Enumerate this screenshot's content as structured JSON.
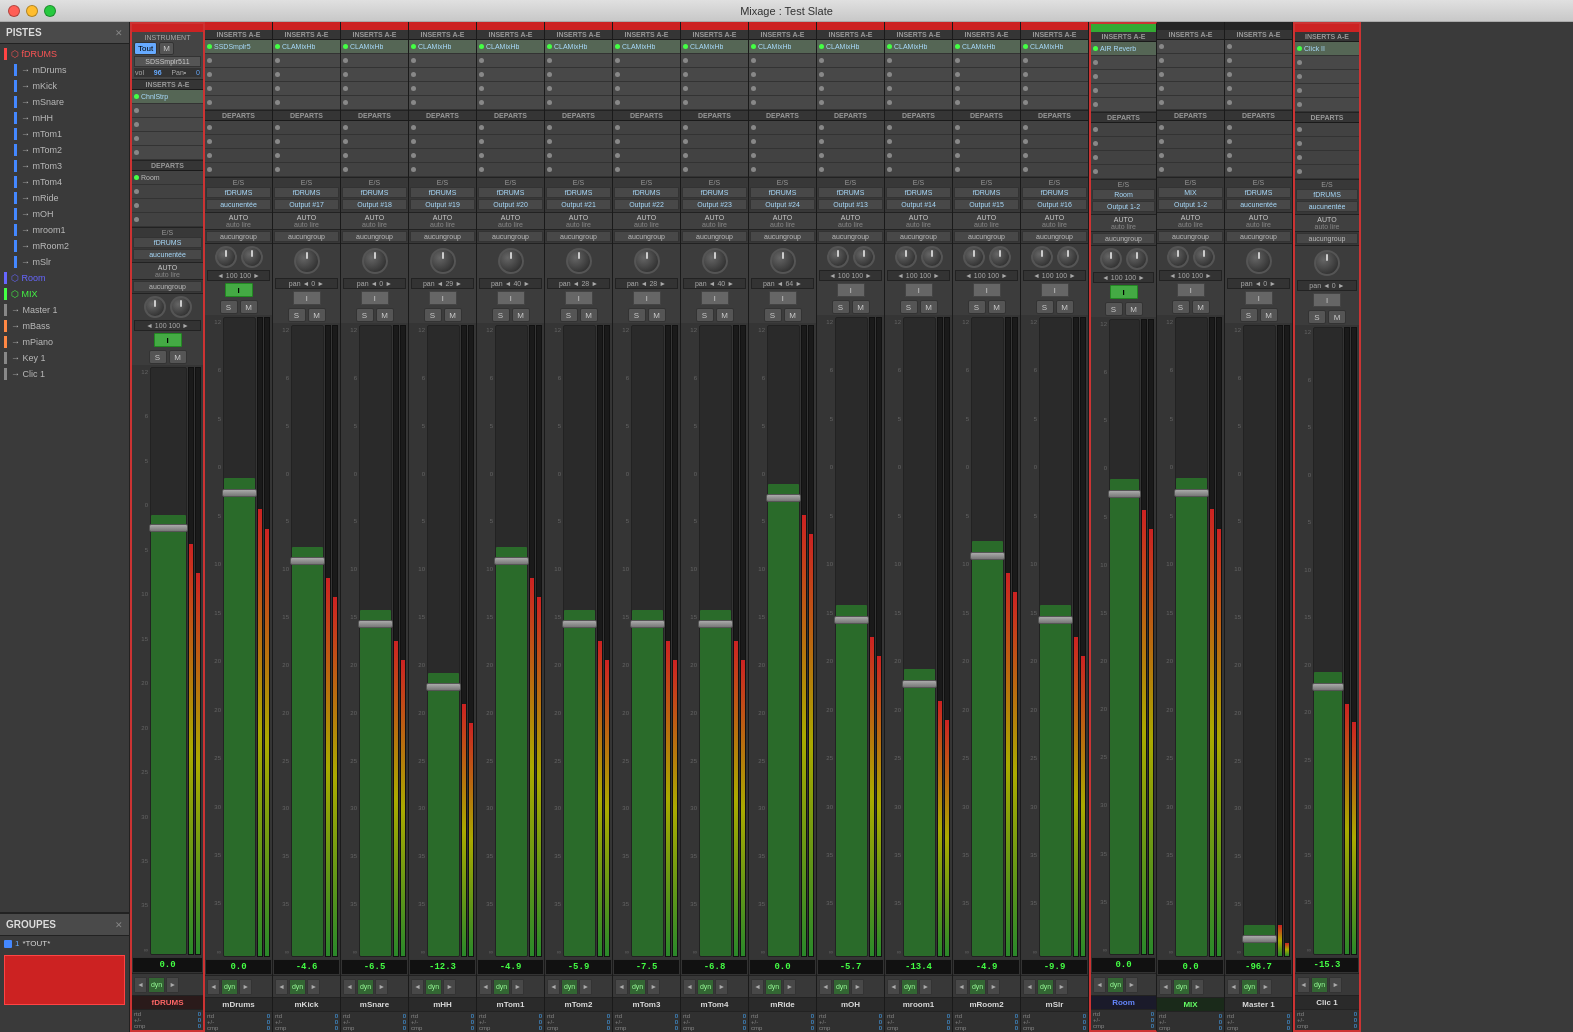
{
  "window": {
    "title": "Mixage : Test Slate"
  },
  "pistes": {
    "label": "PISTES",
    "tracks": [
      {
        "name": "fDRUMS",
        "type": "group",
        "color": "#ff4444",
        "indent": 0
      },
      {
        "name": "mDrums",
        "type": "track",
        "color": "#4488ff",
        "indent": 1
      },
      {
        "name": "mKick",
        "type": "track",
        "color": "#4488ff",
        "indent": 1
      },
      {
        "name": "mSnare",
        "type": "track",
        "color": "#4488ff",
        "indent": 1
      },
      {
        "name": "mHH",
        "type": "track",
        "color": "#4488ff",
        "indent": 1
      },
      {
        "name": "mTom1",
        "type": "track",
        "color": "#4488ff",
        "indent": 1
      },
      {
        "name": "mTom2",
        "type": "track",
        "color": "#4488ff",
        "indent": 1
      },
      {
        "name": "mTom3",
        "type": "track",
        "color": "#4488ff",
        "indent": 1
      },
      {
        "name": "mTom4",
        "type": "track",
        "color": "#4488ff",
        "indent": 1
      },
      {
        "name": "mRide",
        "type": "track",
        "color": "#4488ff",
        "indent": 1
      },
      {
        "name": "mOH",
        "type": "track",
        "color": "#4488ff",
        "indent": 1
      },
      {
        "name": "mroom1",
        "type": "track",
        "color": "#4488ff",
        "indent": 1
      },
      {
        "name": "mRoom2",
        "type": "track",
        "color": "#4488ff",
        "indent": 1
      },
      {
        "name": "mSlr",
        "type": "track",
        "color": "#4488ff",
        "indent": 1
      },
      {
        "name": "Room",
        "type": "group",
        "color": "#6666ff",
        "indent": 0
      },
      {
        "name": "MIX",
        "type": "group",
        "color": "#66ff66",
        "indent": 0
      },
      {
        "name": "Master 1",
        "type": "track",
        "color": "#aaaaaa",
        "indent": 0
      },
      {
        "name": "mBass",
        "type": "track",
        "color": "#ffaa44",
        "indent": 0
      },
      {
        "name": "mPiano",
        "type": "track",
        "color": "#ffaa44",
        "indent": 0
      },
      {
        "name": "Key 1",
        "type": "track",
        "color": "#aaaaaa",
        "indent": 0
      },
      {
        "name": "Clic 1",
        "type": "track",
        "color": "#aaaaaa",
        "indent": 0
      }
    ]
  },
  "groupes": {
    "label": "GROUPES",
    "items": [
      {
        "id": "1",
        "name": "*TOUT*",
        "color": "#4488ff"
      }
    ]
  },
  "channels": [
    {
      "id": "fDRUMS",
      "name": "fDRUMS",
      "nameColor": "red",
      "topBar": "red",
      "hasInstrument": true,
      "instrumentLabel": "INSTRUMENT",
      "instrumentBtn1": "Tout",
      "instrumentBtn2": "M",
      "instrumentName": "SDSSmplr511",
      "vol": "96",
      "pan": "0",
      "inserts": "INSERTS A-E",
      "insertSlots": [
        "ChnlStrp",
        "",
        "",
        "",
        ""
      ],
      "departs": "DEPARTS",
      "departSlots": [
        "Room",
        "",
        "",
        ""
      ],
      "es1": "E/S",
      "esInput": "fDRUMS",
      "esOutput": "aucunentée",
      "auto": "AUTO",
      "autoVal": "auto lire",
      "group": "aucungroup",
      "knobs": 2,
      "panVal": "◄ 100  100 ►",
      "active": true,
      "hasRec": true,
      "value": "0.0"
    },
    {
      "id": "mDrums",
      "name": "mDrums",
      "nameColor": "white",
      "topBar": "red",
      "inserts": "INSERTS A-E",
      "insertSlots": [
        "SSDSmplr5",
        "",
        "",
        "",
        ""
      ],
      "departs": "DEPARTS",
      "departSlots": [
        "",
        "",
        "",
        ""
      ],
      "es1": "E/S",
      "esInput": "fDRUMS",
      "esOutput": "aucunentée",
      "auto": "AUTO",
      "autoVal": "auto lire",
      "group": "aucungroup",
      "knobs": 2,
      "panVal": "◄ 100  100 ►",
      "active": true,
      "value": "0.0"
    },
    {
      "id": "mKick",
      "name": "mKick",
      "nameColor": "white",
      "topBar": "red",
      "inserts": "INSERTS A-E",
      "insertSlots": [
        "CLAMixHb",
        "",
        "",
        "",
        ""
      ],
      "departs": "DEPARTS",
      "departSlots": [
        "",
        "",
        "",
        ""
      ],
      "es1": "E/S",
      "esInput": "fDRUMS",
      "esOutput": "Output #17",
      "auto": "AUTO",
      "autoVal": "auto lire",
      "group": "aucungroup",
      "knobs": 1,
      "panVal": "pan ◄ 0 ►",
      "active": false,
      "value": "-4.6"
    },
    {
      "id": "mSnare",
      "name": "mSnare",
      "nameColor": "white",
      "topBar": "red",
      "inserts": "INSERTS A-E",
      "insertSlots": [
        "CLAMixHb",
        "",
        "",
        "",
        ""
      ],
      "departs": "DEPARTS",
      "departSlots": [
        "",
        "",
        "",
        ""
      ],
      "es1": "E/S",
      "esInput": "fDRUMS",
      "esOutput": "Output #18",
      "auto": "AUTO",
      "autoVal": "auto lire",
      "group": "aucungroup",
      "knobs": 1,
      "panVal": "pan ◄ 0 ►",
      "active": false,
      "value": "-6.5"
    },
    {
      "id": "mHH",
      "name": "mHH",
      "nameColor": "white",
      "topBar": "red",
      "inserts": "INSERTS A-E",
      "insertSlots": [
        "CLAMixHb",
        "",
        "",
        "",
        ""
      ],
      "departs": "DEPARTS",
      "departSlots": [
        "",
        "",
        "",
        ""
      ],
      "es1": "E/S",
      "esInput": "fDRUMS",
      "esOutput": "Output #19",
      "auto": "AUTO",
      "autoVal": "auto lire",
      "group": "aucungroup",
      "knobs": 1,
      "panVal": "pan ◄ 29 ►",
      "active": false,
      "value": "-12.3"
    },
    {
      "id": "mTom1",
      "name": "mTom1",
      "nameColor": "white",
      "topBar": "red",
      "inserts": "INSERTS A-E",
      "insertSlots": [
        "CLAMixHb",
        "",
        "",
        "",
        ""
      ],
      "departs": "DEPARTS",
      "departSlots": [
        "",
        "",
        "",
        ""
      ],
      "es1": "E/S",
      "esInput": "fDRUMS",
      "esOutput": "Output #20",
      "auto": "AUTO",
      "autoVal": "auto lire",
      "group": "aucungroup",
      "knobs": 1,
      "panVal": "pan ◄ 40 ►",
      "active": false,
      "value": "-4.9"
    },
    {
      "id": "mTom2",
      "name": "mTom2",
      "nameColor": "white",
      "topBar": "red",
      "inserts": "INSERTS A-E",
      "insertSlots": [
        "CLAMixHb",
        "",
        "",
        "",
        ""
      ],
      "departs": "DEPARTS",
      "departSlots": [
        "",
        "",
        "",
        ""
      ],
      "es1": "E/S",
      "esInput": "fDRUMS",
      "esOutput": "Output #21",
      "auto": "AUTO",
      "autoVal": "auto lire",
      "group": "aucungroup",
      "knobs": 1,
      "panVal": "pan ◄ 28 ►",
      "active": false,
      "value": "-5.9"
    },
    {
      "id": "mTom3",
      "name": "mTom3",
      "nameColor": "white",
      "topBar": "red",
      "inserts": "INSERTS A-E",
      "insertSlots": [
        "CLAMixHb",
        "",
        "",
        "",
        ""
      ],
      "departs": "DEPARTS",
      "departSlots": [
        "",
        "",
        "",
        ""
      ],
      "es1": "E/S",
      "esInput": "fDRUMS",
      "esOutput": "Output #22",
      "auto": "AUTO",
      "autoVal": "auto lire",
      "group": "aucungroup",
      "knobs": 1,
      "panVal": "pan ◄ 28 ►",
      "active": false,
      "value": "-7.5"
    },
    {
      "id": "mTom4",
      "name": "mTom4",
      "nameColor": "white",
      "topBar": "red",
      "inserts": "INSERTS A-E",
      "insertSlots": [
        "CLAMixHb",
        "",
        "",
        "",
        ""
      ],
      "departs": "DEPARTS",
      "departSlots": [
        "",
        "",
        "",
        ""
      ],
      "es1": "E/S",
      "esInput": "fDRUMS",
      "esOutput": "Output #23",
      "auto": "AUTO",
      "autoVal": "auto lire",
      "group": "aucungroup",
      "knobs": 1,
      "panVal": "pan ◄ 40 ►",
      "active": false,
      "value": "-6.8"
    },
    {
      "id": "mRide",
      "name": "mRide",
      "nameColor": "white",
      "topBar": "red",
      "inserts": "INSERTS A-E",
      "insertSlots": [
        "CLAMixHb",
        "",
        "",
        "",
        ""
      ],
      "departs": "DEPARTS",
      "departSlots": [
        "",
        "",
        "",
        ""
      ],
      "es1": "E/S",
      "esInput": "fDRUMS",
      "esOutput": "Output #24",
      "auto": "AUTO",
      "autoVal": "auto lire",
      "group": "aucungroup",
      "knobs": 1,
      "panVal": "pan ◄ 64 ►",
      "active": false,
      "value": "0.0"
    },
    {
      "id": "mOH",
      "name": "mOH",
      "nameColor": "white",
      "topBar": "red",
      "inserts": "INSERTS A-E",
      "insertSlots": [
        "CLAMixHb",
        "",
        "",
        "",
        ""
      ],
      "departs": "DEPARTS",
      "departSlots": [
        "",
        "",
        "",
        ""
      ],
      "es1": "E/S",
      "esInput": "fDRUMS",
      "esOutput": "Output #13",
      "auto": "AUTO",
      "autoVal": "auto lire",
      "group": "aucungroup",
      "knobs": 2,
      "panVal": "◄ 100  100 ►",
      "active": false,
      "value": "-5.7"
    },
    {
      "id": "mroom1",
      "name": "mroom1",
      "nameColor": "white",
      "topBar": "red",
      "inserts": "INSERTS A-E",
      "insertSlots": [
        "CLAMixHb",
        "",
        "",
        "",
        ""
      ],
      "departs": "DEPARTS",
      "departSlots": [
        "",
        "",
        "",
        ""
      ],
      "es1": "E/S",
      "esInput": "fDRUMS",
      "esOutput": "Output #14",
      "auto": "AUTO",
      "autoVal": "auto lire",
      "group": "aucungroup",
      "knobs": 2,
      "panVal": "◄ 100  100 ►",
      "active": false,
      "value": "-13.4"
    },
    {
      "id": "mRoom2",
      "name": "mRoom2",
      "nameColor": "white",
      "topBar": "red",
      "inserts": "INSERTS A-E",
      "insertSlots": [
        "CLAMixHb",
        "",
        "",
        "",
        ""
      ],
      "departs": "DEPARTS",
      "departSlots": [
        "",
        "",
        "",
        ""
      ],
      "es1": "E/S",
      "esInput": "fDRUMS",
      "esOutput": "Output #15",
      "auto": "AUTO",
      "autoVal": "auto lire",
      "group": "aucungroup",
      "knobs": 2,
      "panVal": "◄ 100  100 ►",
      "active": false,
      "value": "-4.9"
    },
    {
      "id": "mSlr",
      "name": "mSlr",
      "nameColor": "white",
      "topBar": "red",
      "inserts": "INSERTS A-E",
      "insertSlots": [
        "CLAMixHb",
        "",
        "",
        "",
        ""
      ],
      "departs": "DEPARTS",
      "departSlots": [
        "",
        "",
        "",
        ""
      ],
      "es1": "E/S",
      "esInput": "fDRUMS",
      "esOutput": "Output #16",
      "auto": "AUTO",
      "autoVal": "auto lire",
      "group": "aucungroup",
      "knobs": 2,
      "panVal": "◄ 100  100 ►",
      "active": false,
      "value": "-9.9"
    },
    {
      "id": "Room",
      "name": "Room",
      "nameColor": "blue",
      "topBar": "green",
      "inserts": "INSERTS A-E",
      "insertSlots": [
        "AIR Reverb",
        "",
        "",
        "",
        ""
      ],
      "departs": "DEPARTS",
      "departSlots": [
        "",
        "",
        "",
        ""
      ],
      "es1": "E/S",
      "esInput": "Room",
      "esOutput": "Output 1-2",
      "auto": "AUTO",
      "autoVal": "auto lire",
      "group": "aucungroup",
      "knobs": 2,
      "panVal": "◄ 100  100 ►",
      "active": true,
      "value": "0.0"
    },
    {
      "id": "MIX",
      "name": "MIX",
      "nameColor": "green",
      "topBar": "dark",
      "inserts": "INSERTS A-E",
      "insertSlots": [
        "",
        "",
        "",
        "",
        ""
      ],
      "departs": "DEPARTS",
      "departSlots": [
        "",
        "",
        "",
        ""
      ],
      "es1": "E/S",
      "esInput": "MIX",
      "esOutput": "Output 1-2",
      "auto": "AUTO",
      "autoVal": "auto lire",
      "group": "aucungroup",
      "knobs": 2,
      "panVal": "◄ 100  100 ►",
      "active": false,
      "value": "0.0"
    },
    {
      "id": "Master1",
      "name": "Master 1",
      "nameColor": "white",
      "topBar": "dark",
      "inserts": "INSERTS A-E",
      "insertSlots": [
        "",
        "",
        "",
        "",
        ""
      ],
      "departs": "DEPARTS",
      "departSlots": [
        "",
        "",
        "",
        ""
      ],
      "es1": "E/S",
      "esInput": "fDRUMS",
      "esOutput": "aucunentée",
      "auto": "AUTO",
      "autoVal": "auto lire",
      "group": "aucungroup",
      "knobs": 1,
      "panVal": "pan ◄ 0 ►",
      "active": false,
      "value": "-96.7"
    },
    {
      "id": "Clic1",
      "name": "Clic 1",
      "nameColor": "white",
      "topBar": "red",
      "inserts": "INSERTS A-E",
      "insertSlots": [
        "Click II",
        "",
        "",
        "",
        ""
      ],
      "departs": "DEPARTS",
      "departSlots": [
        "",
        "",
        "",
        ""
      ],
      "es1": "E/S",
      "esInput": "fDRUMS",
      "esOutput": "aucunentée",
      "auto": "AUTO",
      "autoVal": "auto lire",
      "group": "aucungroup",
      "knobs": 1,
      "panVal": "pan ◄ 0 ►",
      "active": false,
      "value": "-15.3"
    }
  ]
}
